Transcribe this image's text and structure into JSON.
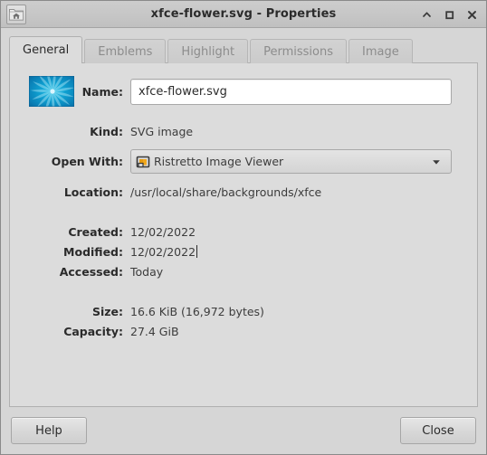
{
  "window": {
    "title": "xfce-flower.svg - Properties",
    "icon": "home-folder-icon",
    "controls": {
      "shade_label": "⌃",
      "maximize_label": "□",
      "close_label": "✕"
    }
  },
  "tabs": [
    {
      "label": "General",
      "active": true
    },
    {
      "label": "Emblems",
      "active": false
    },
    {
      "label": "Highlight",
      "active": false
    },
    {
      "label": "Permissions",
      "active": false
    },
    {
      "label": "Image",
      "active": false
    }
  ],
  "general": {
    "name": {
      "label": "Name:",
      "value": "xfce-flower.svg",
      "thumbnail": "xfce-flower-thumbnail"
    },
    "kind": {
      "label": "Kind:",
      "value": "SVG image"
    },
    "open_with": {
      "label": "Open With:",
      "value": "Ristretto Image Viewer",
      "icon": "image-viewer-icon",
      "arrow": "chevron-down-icon"
    },
    "location": {
      "label": "Location:",
      "value": "/usr/local/share/backgrounds/xfce"
    },
    "created": {
      "label": "Created:",
      "value": "12/02/2022"
    },
    "modified": {
      "label": "Modified:",
      "value": "12/02/2022"
    },
    "accessed": {
      "label": "Accessed:",
      "value": "Today"
    },
    "size": {
      "label": "Size:",
      "value": "16.6  KiB (16,972 bytes)"
    },
    "capacity": {
      "label": "Capacity:",
      "value": "27.4  GiB"
    }
  },
  "actions": {
    "help_label": "Help",
    "close_label": "Close"
  },
  "colors": {
    "window_bg": "#d6d6d6",
    "page_bg": "#dcdcdc",
    "titlebar_bg": "#c6c6c6",
    "text": "#2b2b2b",
    "muted_text": "#8c8c8c",
    "thumbnail_accent": "#0aa6d8"
  }
}
